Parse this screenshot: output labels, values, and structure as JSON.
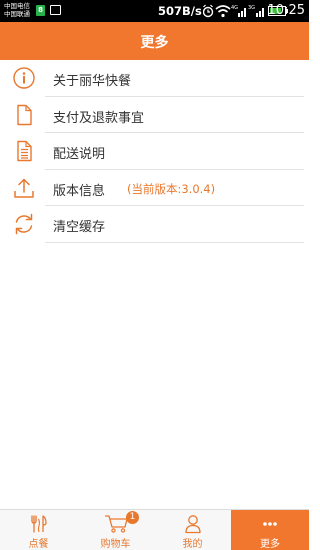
{
  "status_bar": {
    "carrier_1": "中国电信",
    "carrier_2": "中国联通",
    "network_speed": "507B/s",
    "signal_3g": "3G",
    "time": "10:25"
  },
  "header": {
    "title": "更多"
  },
  "menu": {
    "items": [
      {
        "label": "关于丽华快餐",
        "icon": "info-icon"
      },
      {
        "label": "支付及退款事宜",
        "icon": "document-icon"
      },
      {
        "label": "配送说明",
        "icon": "document-lines-icon"
      },
      {
        "label": "版本信息",
        "icon": "upload-icon",
        "extra": "(当前版本:3.0.4)"
      },
      {
        "label": "清空缓存",
        "icon": "refresh-icon"
      }
    ]
  },
  "bottom_nav": {
    "tabs": [
      {
        "label": "点餐",
        "icon": "fork-knife-icon"
      },
      {
        "label": "购物车",
        "icon": "cart-icon",
        "badge": "1"
      },
      {
        "label": "我的",
        "icon": "person-icon"
      },
      {
        "label": "更多",
        "icon": "more-dots-icon",
        "active": true
      }
    ]
  },
  "colors": {
    "accent": "#f1772e",
    "text": "#333333",
    "divider": "#e2e2e2"
  }
}
